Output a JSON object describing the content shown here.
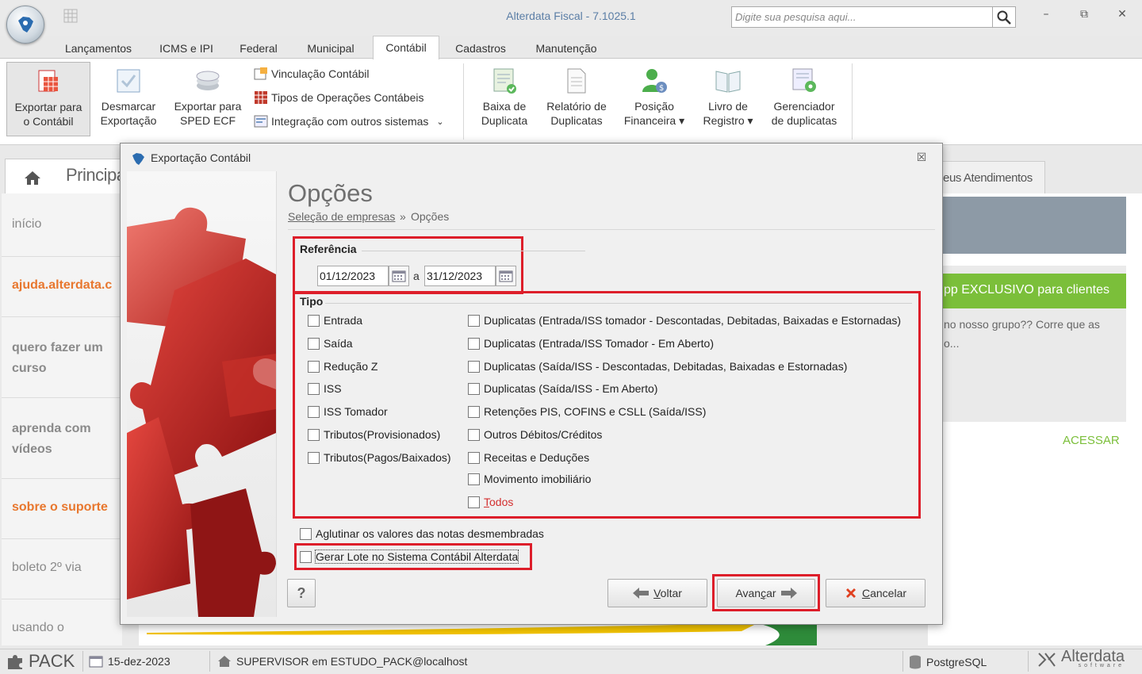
{
  "window": {
    "title": "Alterdata Fiscal - 7.1025.1",
    "search_placeholder": "Digite sua pesquisa aqui...",
    "controls": {
      "minimize": "–",
      "restore": "⧉",
      "close": "✕"
    }
  },
  "menu": {
    "tabs": [
      {
        "label": "Lançamentos"
      },
      {
        "label": "ICMS e IPI"
      },
      {
        "label": "Federal"
      },
      {
        "label": "Municipal"
      },
      {
        "label": "Contábil"
      },
      {
        "label": "Cadastros"
      },
      {
        "label": "Manutenção"
      }
    ],
    "active": "Contábil"
  },
  "ribbon": {
    "large_buttons": [
      {
        "line1": "Exportar para",
        "line2": "o Contábil",
        "icon": "spreadsheet-icon"
      },
      {
        "line1": "Desmarcar",
        "line2": "Exportação",
        "icon": "checkbox-icon"
      },
      {
        "line1": "Exportar para",
        "line2": "SPED ECF",
        "icon": "coins-icon"
      }
    ],
    "small_items": [
      {
        "label": "Vinculação Contábil",
        "icon": "link-table-icon"
      },
      {
        "label": "Tipos de Operações Contábeis",
        "icon": "table-icon"
      },
      {
        "label": "Integração com outros sistemas",
        "icon": "integration-icon",
        "dropdown": "⌄"
      }
    ],
    "duplicatas_buttons": [
      {
        "line1": "Baixa de",
        "line2": "Duplicata",
        "icon": "doc-check-icon"
      },
      {
        "line1": "Relatório de",
        "line2": "Duplicatas",
        "icon": "report-icon"
      },
      {
        "line1": "Posição",
        "line2": "Financeira ▾",
        "icon": "person-money-icon"
      },
      {
        "line1": "Livro de",
        "line2": "Registro ▾",
        "icon": "book-icon"
      },
      {
        "line1": "Gerenciador",
        "line2": "de duplicatas",
        "icon": "doc-gear-icon"
      }
    ]
  },
  "background": {
    "home_tab": "Principa",
    "side_items": [
      {
        "label": "início",
        "color": "#8a8a8a"
      },
      {
        "label": "ajuda.alterdata.c",
        "color": "#e8772e"
      },
      {
        "label": "quero fazer um",
        "label2": "curso",
        "color": "#8a8a8a"
      },
      {
        "label": "aprenda com",
        "label2": "vídeos",
        "color": "#8a8a8a"
      },
      {
        "label": "sobre o suporte",
        "color": "#e8772e"
      },
      {
        "label": "boleto 2º via",
        "color": "#8a8a8a"
      },
      {
        "label": "usando o",
        "color": "#8a8a8a"
      }
    ],
    "atendimentos_tab": "eus Atendimentos",
    "card_title": "pp EXCLUSIVO para clientes",
    "card_text_line1": "no nosso grupo?? Corre que as",
    "card_text_line2": "o...",
    "card_action": "ACESSAR"
  },
  "dialog": {
    "title": "Exportação Contábil",
    "close": "☒",
    "heading": "Opções",
    "breadcrumb_link": "Seleção de empresas",
    "breadcrumb_sep": "»",
    "breadcrumb_current": "Opções",
    "referencia": {
      "label": "Referência",
      "date_from": "01/12/2023",
      "separator": "a",
      "date_to": "31/12/2023"
    },
    "tipo": {
      "label": "Tipo",
      "left": [
        {
          "label": "Entrada"
        },
        {
          "label": "Saída"
        },
        {
          "label": "Redução Z"
        },
        {
          "label": "ISS"
        },
        {
          "label": "ISS Tomador"
        },
        {
          "label": "Tributos(Provisionados)"
        },
        {
          "label": "Tributos(Pagos/Baixados)"
        }
      ],
      "right": [
        {
          "label": "Duplicatas (Entrada/ISS tomador - Descontadas, Debitadas, Baixadas e Estornadas)"
        },
        {
          "label": "Duplicatas (Entrada/ISS Tomador - Em Aberto)"
        },
        {
          "label": "Duplicatas (Saída/ISS - Descontadas, Debitadas, Baixadas e Estornadas)"
        },
        {
          "label": "Duplicatas (Saída/ISS - Em Aberto)"
        },
        {
          "label": "Retenções PIS, COFINS e CSLL (Saída/ISS)"
        },
        {
          "label": "Outros Débitos/Créditos"
        },
        {
          "label": "Receitas e Deduções"
        },
        {
          "label": "Movimento imobiliário"
        }
      ],
      "todos_first": "T",
      "todos_rest": "odos"
    },
    "aglutinar": "Aglutinar os valores das notas desmembradas",
    "gerar_lote": "Gerar Lote no Sistema Contábil Alterdata",
    "help_button": "?",
    "voltar_first": "V",
    "voltar_rest": "oltar",
    "avancar_pre": "Avan",
    "avancar_u": "ç",
    "avancar_post": "ar",
    "cancelar_first": "C",
    "cancelar_rest": "ancelar"
  },
  "statusbar": {
    "product": "PACK",
    "date": "15-dez-2023",
    "user": "SUPERVISOR em ESTUDO_PACK@localhost",
    "database": "PostgreSQL",
    "brand": "Alterdata",
    "brand_sub": "software"
  },
  "colors": {
    "highlight_red": "#dd1e2a",
    "accent_orange": "#e8772e",
    "accent_green": "#7bbf3a",
    "title_blue": "#5b7ea6"
  }
}
